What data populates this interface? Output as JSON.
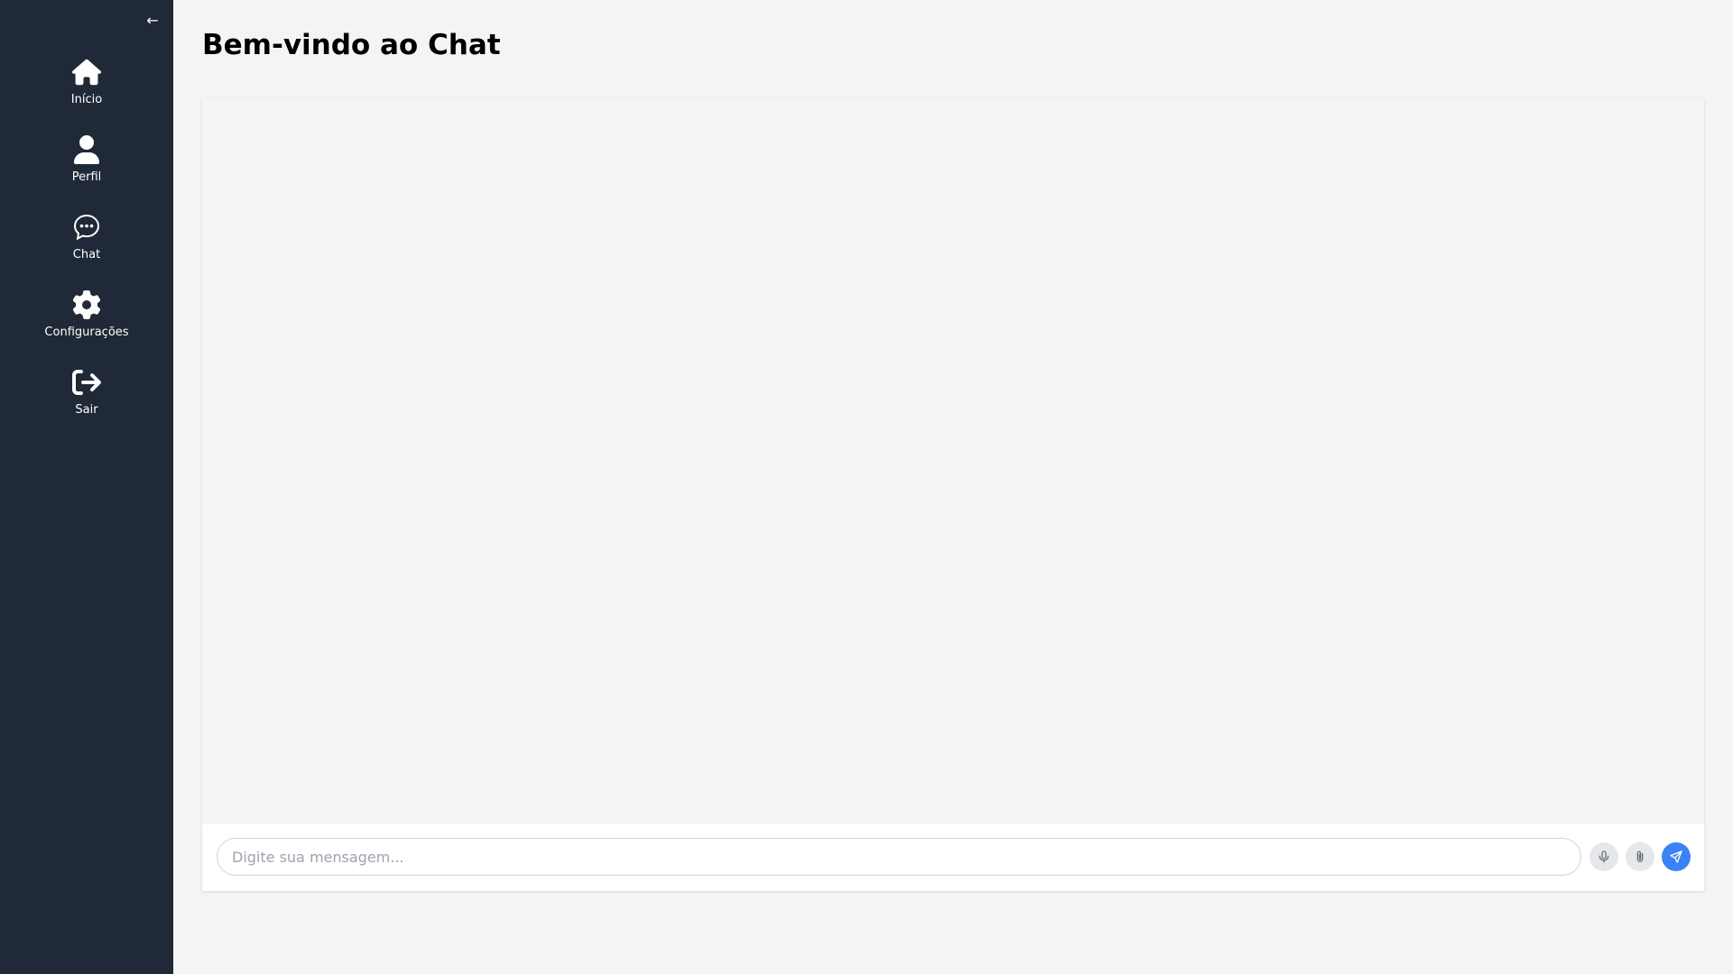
{
  "sidebar": {
    "collapse_label": "←",
    "items": [
      {
        "label": "Início",
        "icon": "home-icon"
      },
      {
        "label": "Perfil",
        "icon": "user-icon"
      },
      {
        "label": "Chat",
        "icon": "chat-icon"
      },
      {
        "label": "Configurações",
        "icon": "gear-icon"
      },
      {
        "label": "Sair",
        "icon": "logout-icon"
      }
    ]
  },
  "main": {
    "title": "Bem-vindo ao Chat"
  },
  "composer": {
    "placeholder": "Digite sua mensagem...",
    "value": "",
    "buttons": [
      {
        "icon": "microphone-icon"
      },
      {
        "icon": "paperclip-icon"
      },
      {
        "icon": "send-icon"
      }
    ]
  },
  "colors": {
    "sidebar_bg": "#1f2937",
    "page_bg": "#f3f4f6",
    "accent": "#3b82f6"
  }
}
